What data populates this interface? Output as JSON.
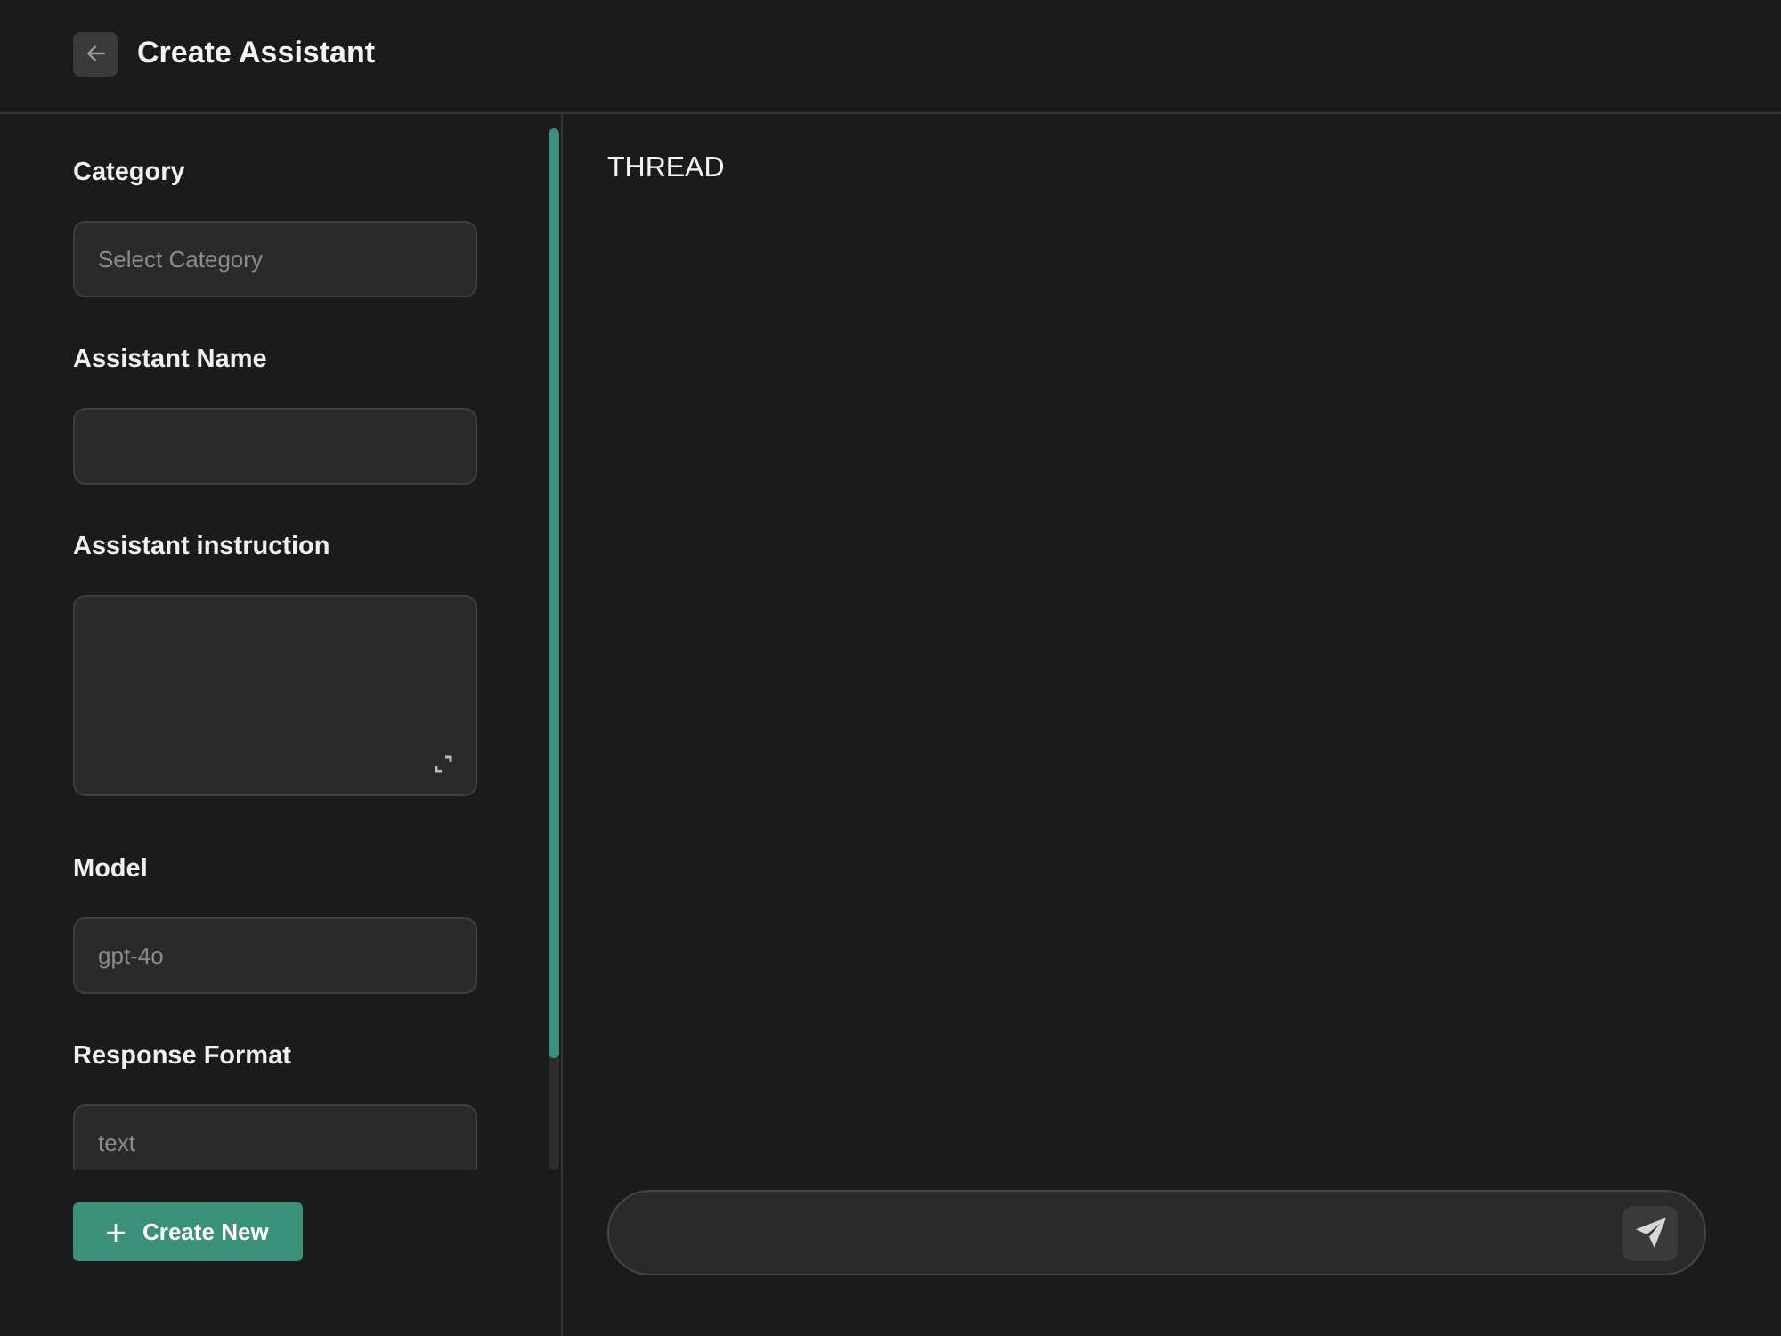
{
  "header": {
    "title": "Create Assistant"
  },
  "form": {
    "fields": [
      {
        "kind": "select",
        "label": "Category",
        "placeholder": "Select Category"
      },
      {
        "kind": "input",
        "label": "Assistant Name"
      },
      {
        "kind": "textarea",
        "label": "Assistant instruction"
      },
      {
        "kind": "input",
        "label": "Model",
        "placeholder": "gpt-4o"
      },
      {
        "kind": "input",
        "label": "Response Format",
        "placeholder": "text"
      }
    ],
    "button": {
      "label": "Create New"
    }
  },
  "thread": {
    "title": "THREAD"
  }
}
